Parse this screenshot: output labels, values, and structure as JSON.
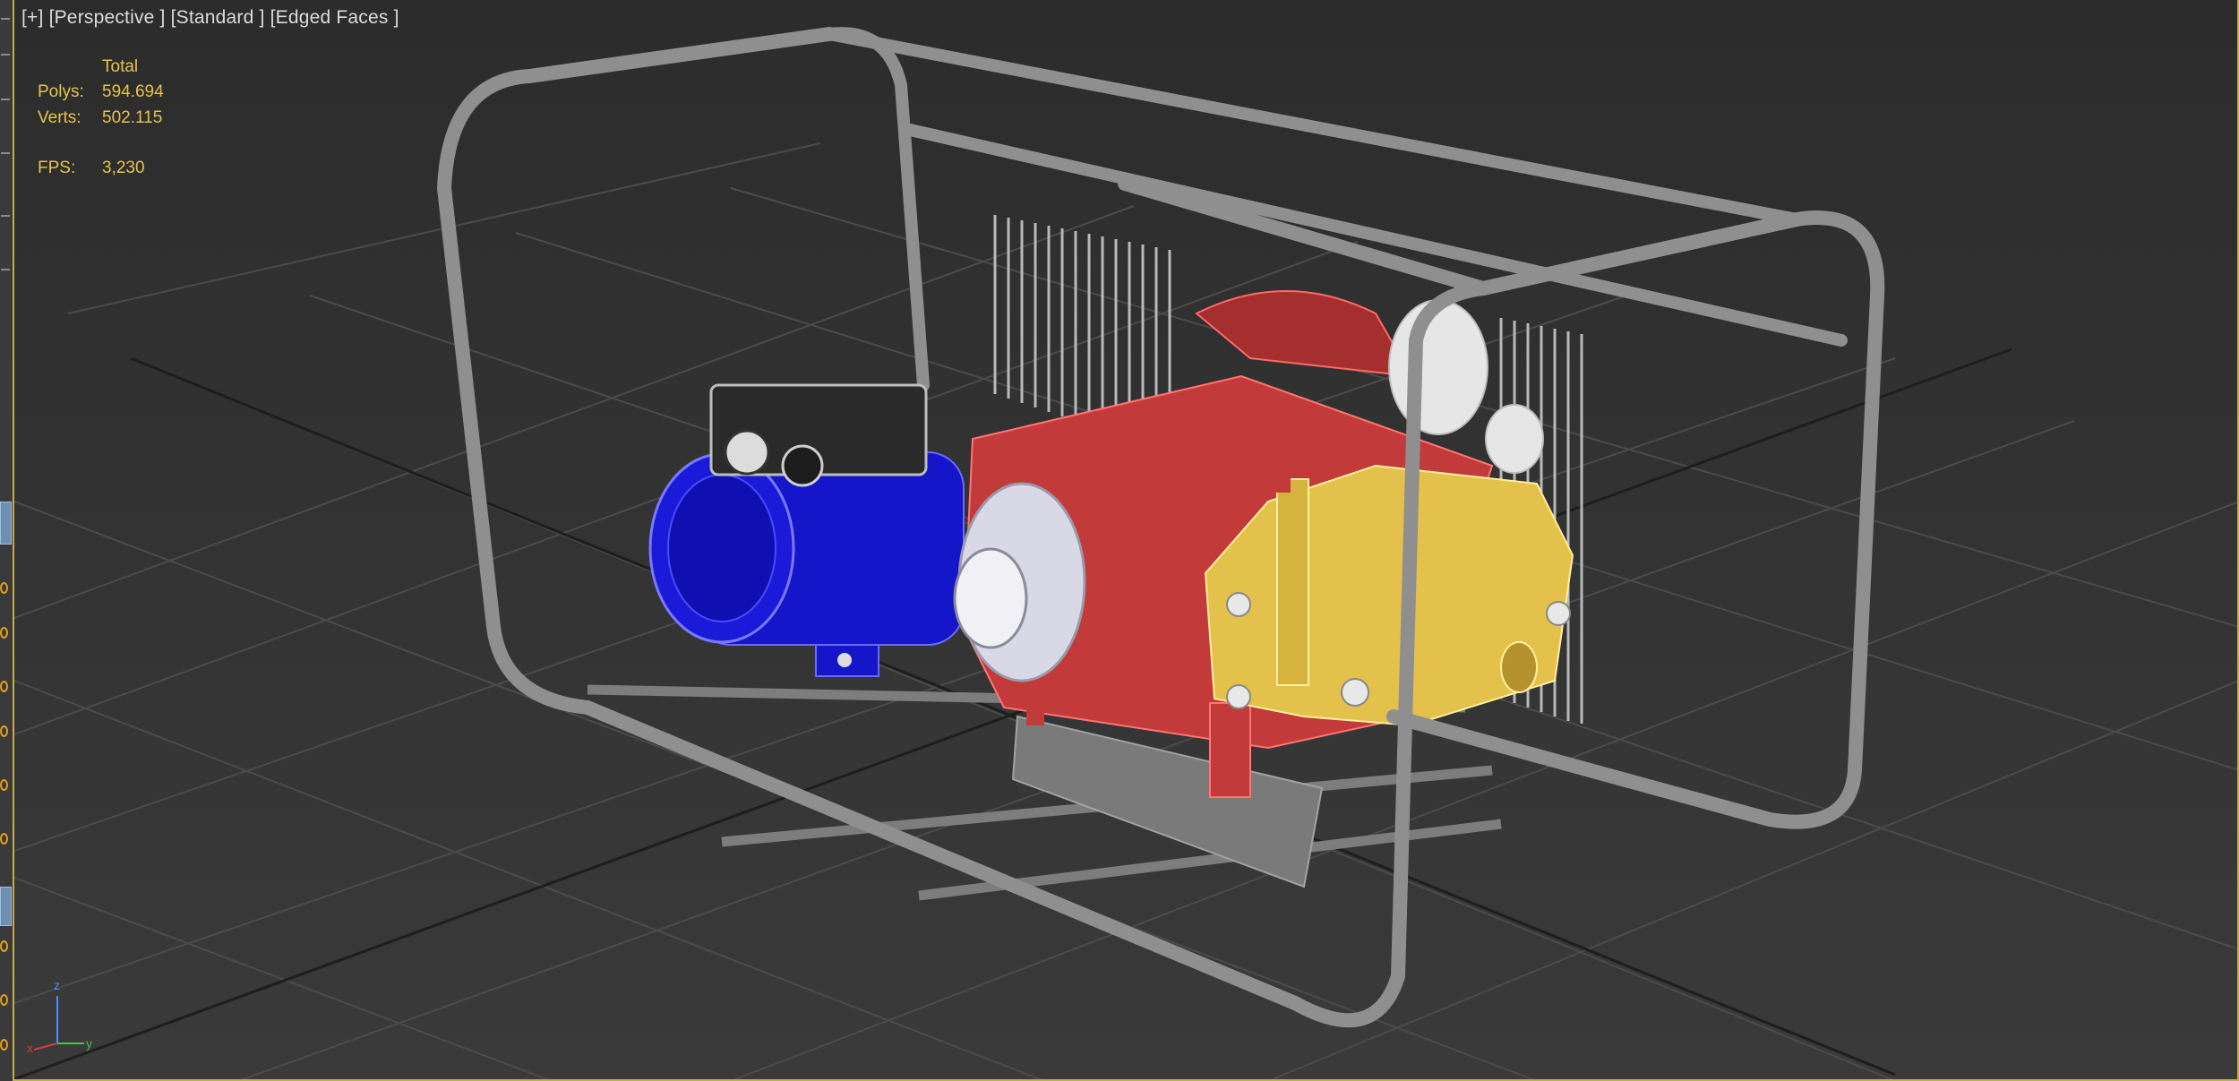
{
  "viewport": {
    "label": "[+] [Perspective ] [Standard ] [Edged Faces ]",
    "stats": {
      "header": "Total",
      "polys_label": "Polys:",
      "polys_value": "594.694",
      "verts_label": "Verts:",
      "verts_value": "502.115",
      "fps_label": "FPS:",
      "fps_value": "3,230"
    },
    "axis_gizmo": {
      "z": "z",
      "x": "x",
      "y": "y"
    }
  },
  "colors": {
    "frame": "#8f8f8f",
    "motor": "#1010d8",
    "pump_body": "#c23a3a",
    "pump_head": "#e4c14a",
    "grid_line": "#4b4b4b",
    "stats_text": "#e6c34a"
  },
  "icons": [
    "viewport-menu-icon",
    "axis-gizmo-icon"
  ]
}
